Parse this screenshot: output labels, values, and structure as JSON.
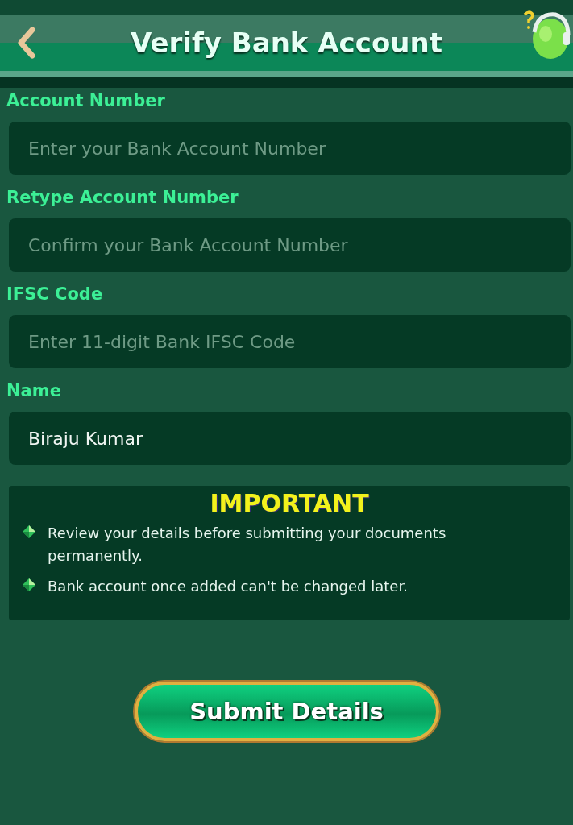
{
  "header": {
    "title": "Verify Bank Account"
  },
  "fields": [
    {
      "label": "Account Number",
      "placeholder": "Enter your Bank Account Number"
    },
    {
      "label": "Retype Account Number",
      "placeholder": "Confirm your Bank Account Number"
    },
    {
      "label": "IFSC Code",
      "placeholder": "Enter 11-digit Bank IFSC Code"
    },
    {
      "label": "Name",
      "value": "Biraju Kumar"
    }
  ],
  "notice": {
    "title": "IMPORTANT",
    "items": [
      "Review your details before submitting your documents permanently.",
      "Bank account once added can't be changed later."
    ]
  },
  "submit_button": "Submit Details"
}
